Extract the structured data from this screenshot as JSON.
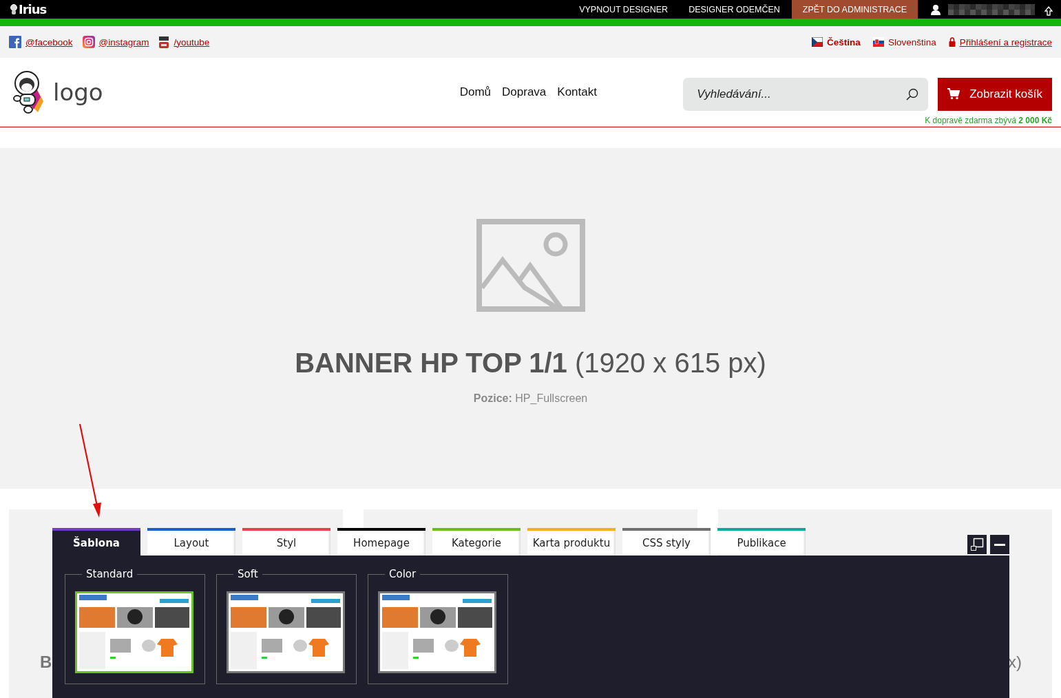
{
  "admin_bar": {
    "logo": "Irius",
    "links": [
      "VYPNOUT DESIGNER",
      "DESIGNER ODEMČEN"
    ],
    "admin_button": "ZPĚT DO ADMINISTRACE"
  },
  "social_links": [
    {
      "kind": "facebook",
      "label": "@facebook"
    },
    {
      "kind": "instagram",
      "label": "@instagram"
    },
    {
      "kind": "youtube",
      "label": "/youtube"
    }
  ],
  "languages": [
    {
      "kind": "czech",
      "label": "Čeština",
      "selected": true
    },
    {
      "kind": "slovak",
      "label": "Slovenština",
      "selected": false
    }
  ],
  "login_link": "Přihlášení a registrace",
  "header": {
    "logo_text": "logo",
    "nav": [
      "Domů",
      "Doprava",
      "Kontakt"
    ],
    "search": {
      "placeholder": "Vyhledávání..."
    },
    "cart_button": "Zobrazit košík",
    "shipping_note": "K dopravě zdarma zbývá **2 000 Kč**"
  },
  "banner": {
    "title": "**BANNER HP TOP 1/1** (1920 x 615 px)",
    "position": "**Pozice:** HP_Fullscreen"
  },
  "cards": [
    {
      "kind": "left",
      "text": "B"
    },
    {
      "kind": "plain"
    },
    {
      "kind": "right",
      "text": "x)"
    }
  ],
  "designer": {
    "tabs": [
      {
        "label": "Šablona",
        "color": "#6f3fc0",
        "selected": true
      },
      {
        "label": "Layout",
        "color": "#1c5fc4",
        "selected": false
      },
      {
        "label": "Styl",
        "color": "#e8414e",
        "selected": false
      },
      {
        "label": "Homepage",
        "color": "#000000",
        "selected": false
      },
      {
        "label": "Kategorie",
        "color": "#6dbb1f",
        "selected": false
      },
      {
        "label": "Karta produktu",
        "color": "#f0b020",
        "selected": false
      },
      {
        "label": "CSS styly",
        "color": "#707070",
        "selected": false
      },
      {
        "label": "Publikace",
        "color": "#10a89a",
        "selected": false
      }
    ],
    "templates": [
      {
        "name": "Standard",
        "selected": true
      },
      {
        "name": "Soft",
        "selected": false
      },
      {
        "name": "Color",
        "selected": false
      }
    ]
  }
}
